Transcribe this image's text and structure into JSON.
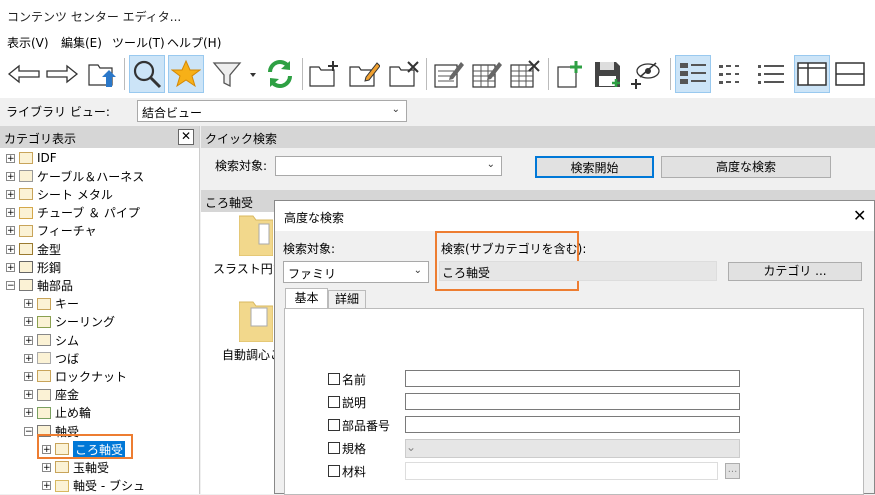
{
  "window": {
    "title": "コンテンツ センター エディタ..."
  },
  "menu": [
    "表示(V)",
    "編集(E)",
    "ツール(T)",
    "ヘルプ(H)"
  ],
  "toolbar": {
    "icons": [
      "back-arrow-icon",
      "forward-arrow-icon",
      "folder-up-icon",
      "search-icon",
      "favorite-star-icon",
      "filter-icon",
      "refresh-icon",
      "new-category-icon",
      "edit-category-icon",
      "delete-category-icon",
      "edit-family-icon",
      "edit-table-icon",
      "delete-family-icon",
      "add-family-icon",
      "save-icon",
      "publish-icon",
      "thumbnail-view-icon",
      "list-view-icon",
      "detail-view-icon",
      "split-view-vertical-icon",
      "split-view-horizontal-icon"
    ]
  },
  "library": {
    "label": "ライブラリ ビュー:",
    "selected": "結合ビュー"
  },
  "category_panel": {
    "title": "カテゴリ表示",
    "items": [
      {
        "label": "IDF",
        "exp": "+",
        "level": 0
      },
      {
        "label": "ケーブル＆ハーネス",
        "exp": "+",
        "level": 0
      },
      {
        "label": "シート メタル",
        "exp": "+",
        "level": 0
      },
      {
        "label": "チューブ ＆ パイプ",
        "exp": "+",
        "level": 0
      },
      {
        "label": "フィーチャ",
        "exp": "+",
        "level": 0
      },
      {
        "label": "金型",
        "exp": "+",
        "level": 0
      },
      {
        "label": "形鋼",
        "exp": "+",
        "level": 0
      },
      {
        "label": "軸部品",
        "exp": "−",
        "level": 0
      },
      {
        "label": "キー",
        "exp": "+",
        "level": 1
      },
      {
        "label": "シーリング",
        "exp": "+",
        "level": 1
      },
      {
        "label": "シム",
        "exp": "+",
        "level": 1
      },
      {
        "label": "つば",
        "exp": "+",
        "level": 1
      },
      {
        "label": "ロックナット",
        "exp": "+",
        "level": 1
      },
      {
        "label": "座金",
        "exp": "+",
        "level": 1
      },
      {
        "label": "止め輪",
        "exp": "+",
        "level": 1
      },
      {
        "label": "軸受",
        "exp": "−",
        "level": 1
      },
      {
        "label": "ころ軸受",
        "exp": "+",
        "level": 2,
        "selected": true
      },
      {
        "label": "玉軸受",
        "exp": "+",
        "level": 2
      },
      {
        "label": "軸受 - ブシュ",
        "exp": "+",
        "level": 2
      }
    ]
  },
  "quick_search": {
    "title": "クイック検索",
    "target_label": "検索対象:",
    "start_button": "検索開始",
    "advanced_button": "高度な検索"
  },
  "content": {
    "title": "ころ軸受",
    "items": [
      "スラスト円すい",
      "自動調心ころ"
    ]
  },
  "dialog": {
    "title": "高度な検索",
    "target_label": "検索対象:",
    "target_value": "ファミリ",
    "scope_label": "検索(サブカテゴリを含む):",
    "scope_value": "ころ軸受",
    "category_button": "カテゴリ ...",
    "tabs": [
      "基本",
      "詳細"
    ],
    "fields": [
      {
        "label": "名前",
        "type": "text"
      },
      {
        "label": "説明",
        "type": "text"
      },
      {
        "label": "部品番号",
        "type": "text"
      },
      {
        "label": "規格",
        "type": "select"
      },
      {
        "label": "材料",
        "type": "browse",
        "browse": "..."
      }
    ]
  },
  "colors": {
    "highlight": "#ed7d31",
    "selection": "#0078d7"
  }
}
